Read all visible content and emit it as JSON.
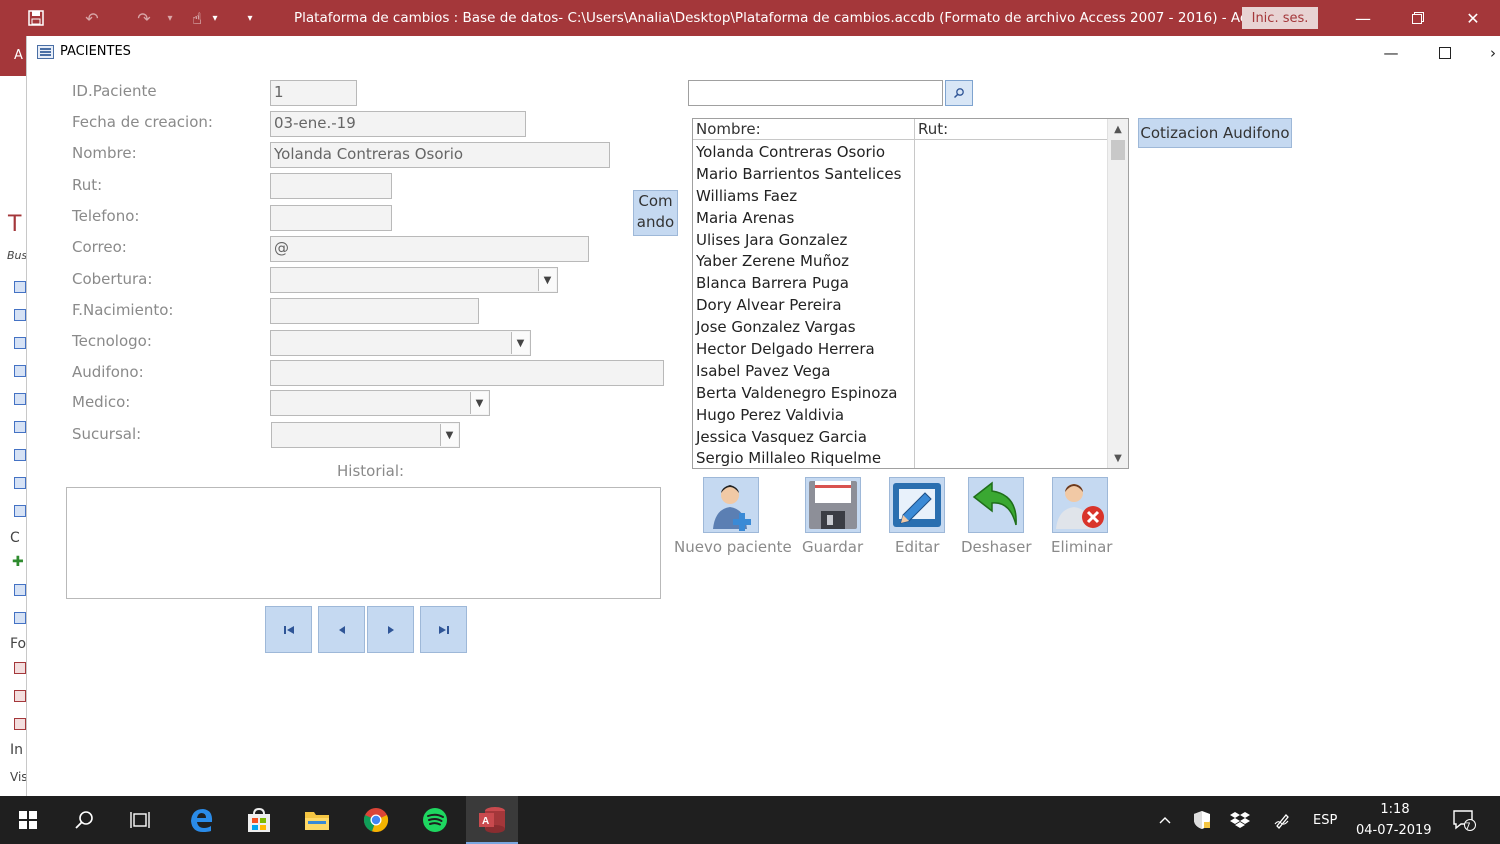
{
  "window": {
    "title": "Plataforma de cambios : Base de datos- C:\\Users\\Analia\\Desktop\\Plataforma de cambios.accdb (Formato de archivo Access 2007 - 2016)  -  Access",
    "signin_label": "Inic. ses.",
    "accent": "#a4373a"
  },
  "nav_pane": {
    "partial_text": [
      "A",
      "T",
      "Bus",
      "C",
      "Fo",
      "In",
      "Vis"
    ]
  },
  "form": {
    "caption": "PACIENTES",
    "fields": {
      "id_paciente": {
        "label": "ID.Paciente",
        "value": "1"
      },
      "fecha_creacion": {
        "label": "Fecha de creacion:",
        "value": "03-ene.-19"
      },
      "nombre": {
        "label": "Nombre:",
        "value": "Yolanda Contreras Osorio"
      },
      "rut": {
        "label": "Rut:",
        "value": ""
      },
      "telefono": {
        "label": "Telefono:",
        "value": ""
      },
      "correo": {
        "label": "Correo:",
        "value": "@"
      },
      "cobertura": {
        "label": "Cobertura:",
        "value": ""
      },
      "f_nacimiento": {
        "label": "F.Nacimiento:",
        "value": ""
      },
      "tecnologo": {
        "label": "Tecnologo:",
        "value": ""
      },
      "audifono": {
        "label": "Audifono:",
        "value": ""
      },
      "medico": {
        "label": "Medico:",
        "value": ""
      },
      "sucursal": {
        "label": "Sucursal:",
        "value": ""
      }
    },
    "historial_label": "Historial:",
    "comando_label_line1": "Com",
    "comando_label_line2": "ando",
    "cotizacion_label": "Cotizacion Audifono",
    "list": {
      "columns": [
        "Nombre:",
        "Rut:"
      ],
      "rows": [
        "Yolanda Contreras Osorio",
        "Mario Barrientos Santelices",
        "Williams Faez",
        "Maria Arenas",
        "Ulises Jara Gonzalez",
        "Yaber Zerene Muñoz",
        "Blanca Barrera Puga",
        "Dory Alvear Pereira",
        "Jose Gonzalez Vargas",
        "Hector Delgado Herrera",
        "Isabel Pavez Vega",
        "Berta Valdenegro Espinoza",
        "Hugo Perez Valdivia",
        "Jessica Vasquez Garcia",
        "Sergio Millaleo Riquelme"
      ]
    },
    "actions": {
      "nuevo": "Nuevo paciente",
      "guardar": "Guardar",
      "editar": "Editar",
      "deshaser": "Deshaser",
      "eliminar": "Eliminar"
    }
  },
  "taskbar": {
    "language": "ESP",
    "time": "1:18",
    "date": "04-07-2019",
    "notifications": "7"
  }
}
